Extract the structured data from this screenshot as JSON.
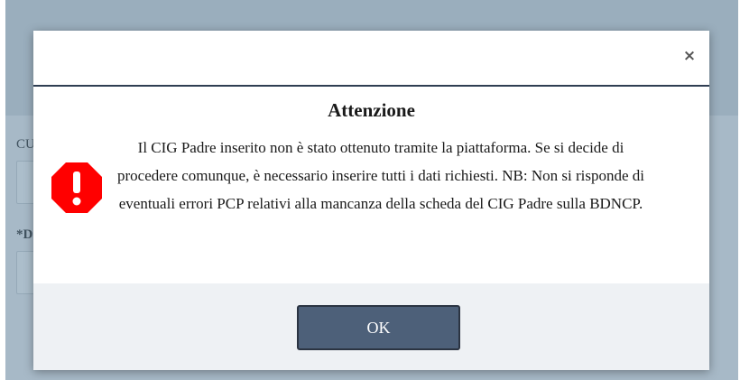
{
  "background": {
    "label_cu": "CU",
    "label_d": "*D"
  },
  "dialog": {
    "title": "Attenzione",
    "close_label": "×",
    "icon": "warning-octagon-icon",
    "message": "Il CIG Padre inserito non è stato ottenuto tramite la piattaforma. Se si decide di procedere comunque, è necessario inserire tutti i dati richiesti. NB: Non si risponde di eventuali errori PCP relativi alla mancanza della scheda del CIG Padre sulla BDNCP.",
    "ok_label": "OK"
  },
  "colors": {
    "warning": "#ff0000",
    "ok_button": "#4d6079",
    "header_divider": "#2f3e52",
    "footer": "#eef1f4"
  }
}
